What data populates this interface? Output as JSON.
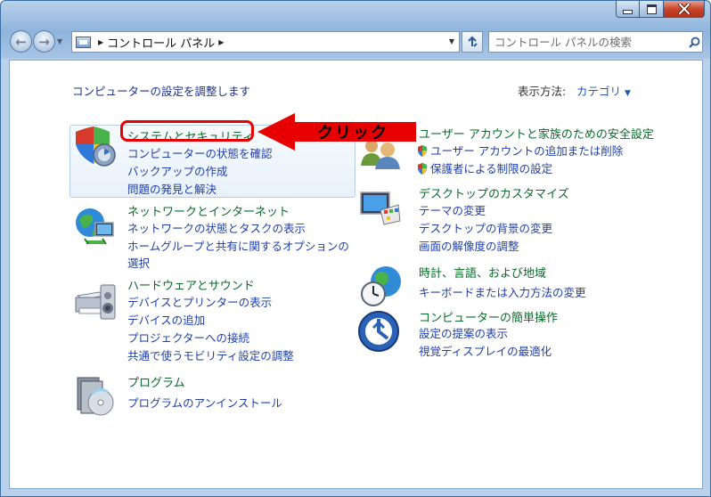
{
  "window": {
    "title_bar_buttons": [
      "minimize",
      "maximize",
      "close"
    ]
  },
  "toolbar": {
    "breadcrumb": "コントロール パネル",
    "search_placeholder": "コントロール パネルの検索"
  },
  "main": {
    "heading": "コンピューターの設定を調整します",
    "view_by_label": "表示方法:",
    "view_by_value": "カテゴリ"
  },
  "left_categories": [
    {
      "title": "システムとセキュリティ",
      "icon": "shield-pc-icon",
      "links": [
        "コンピューターの状態を確認",
        "バックアップの作成",
        "問題の発見と解決"
      ]
    },
    {
      "title": "ネットワークとインターネット",
      "icon": "network-globe-icon",
      "links": [
        "ネットワークの状態とタスクの表示",
        "ホームグループと共有に関するオプションの",
        "選択"
      ]
    },
    {
      "title": "ハードウェアとサウンド",
      "icon": "printer-speaker-icon",
      "links": [
        "デバイスとプリンターの表示",
        "デバイスの追加",
        "プロジェクターへの接続",
        "共通で使うモビリティ設定の調整"
      ]
    },
    {
      "title": "プログラム",
      "icon": "programs-cd-icon",
      "links": [
        "プログラムのアンインストール"
      ]
    }
  ],
  "right_categories": [
    {
      "title": "ユーザー アカウントと家族のための安全設定",
      "icon": "users-icon",
      "links": [
        "ユーザー アカウントの追加または削除",
        "保護者による制限の設定"
      ]
    },
    {
      "title": "デスクトップのカスタマイズ",
      "icon": "monitor-palette-icon",
      "links": [
        "テーマの変更",
        "デスクトップの背景の変更",
        "画面の解像度の調整"
      ]
    },
    {
      "title": "時計、言語、および地域",
      "icon": "globe-clock-icon",
      "links": [
        "キーボードまたは入力方法の変更"
      ]
    },
    {
      "title": "コンピューターの簡単操作",
      "icon": "ease-of-access-icon",
      "links": [
        "設定の提案の表示",
        "視覚ディスプレイの最適化"
      ]
    }
  ],
  "annotation": {
    "label": "クリック",
    "color": "#e60000"
  }
}
